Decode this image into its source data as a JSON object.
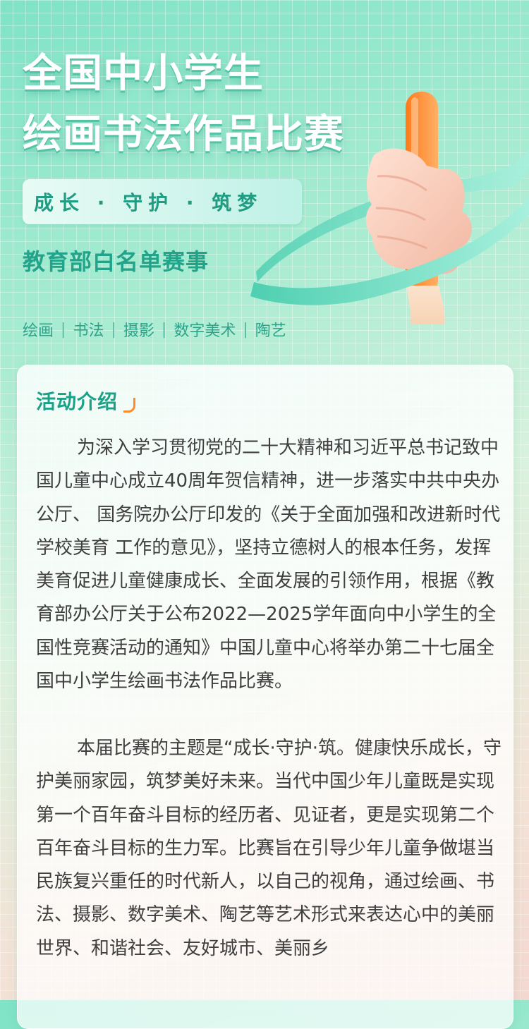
{
  "header": {
    "title_line1": "全国中小学生",
    "title_line2": "绘画书法作品比赛",
    "slogan": "成长 · 守护 · 筑梦",
    "subtitle": "教育部白名单赛事",
    "categories": [
      "绘画",
      "书法",
      "摄影",
      "数字美术",
      "陶艺"
    ]
  },
  "colors": {
    "accent": "#1aa187",
    "brush_orange": "#ff8a2a",
    "ribbon_teal": "#6fd8c0",
    "text": "#3f3f3f"
  },
  "intro": {
    "title": "活动介绍",
    "paragraph1": "为深入学习贯彻党的二十大精神和习近平总书记致中国儿童中心成立40周年贺信精神，进一步落实中共中央办公厅、 国务院办公厅印发的《关于全面加强和改进新时代学校美育 工作的意见》，坚持立德树人的根本任务，发挥美育促进儿童健康成长、全面发展的引领作用，根据《教育部办公厅关于公布2022—2025学年面向中小学生的全国性竞赛活动的通知》中国儿童中心将举办第二十七届全国中小学生绘画书法作品比赛。",
    "paragraph2": "本届比赛的主题是“成长·守护·筑。健康快乐成长，守护美丽家园，筑梦美好未来。当代中国少年儿童既是实现第一个百年奋斗目标的经历者、见证者，更是实现第二个百年奋斗目标的生力军。比赛旨在引导少年儿童争做堪当民族复兴重任的时代新人，以自己的视角，通过绘画、书法、摄影、数字美术、陶艺等艺术形式来表达心中的美丽世界、和谐社会、友好城市、美丽乡"
  },
  "illustration": {
    "icon": "thumbs-up-paintbrush-icon"
  }
}
